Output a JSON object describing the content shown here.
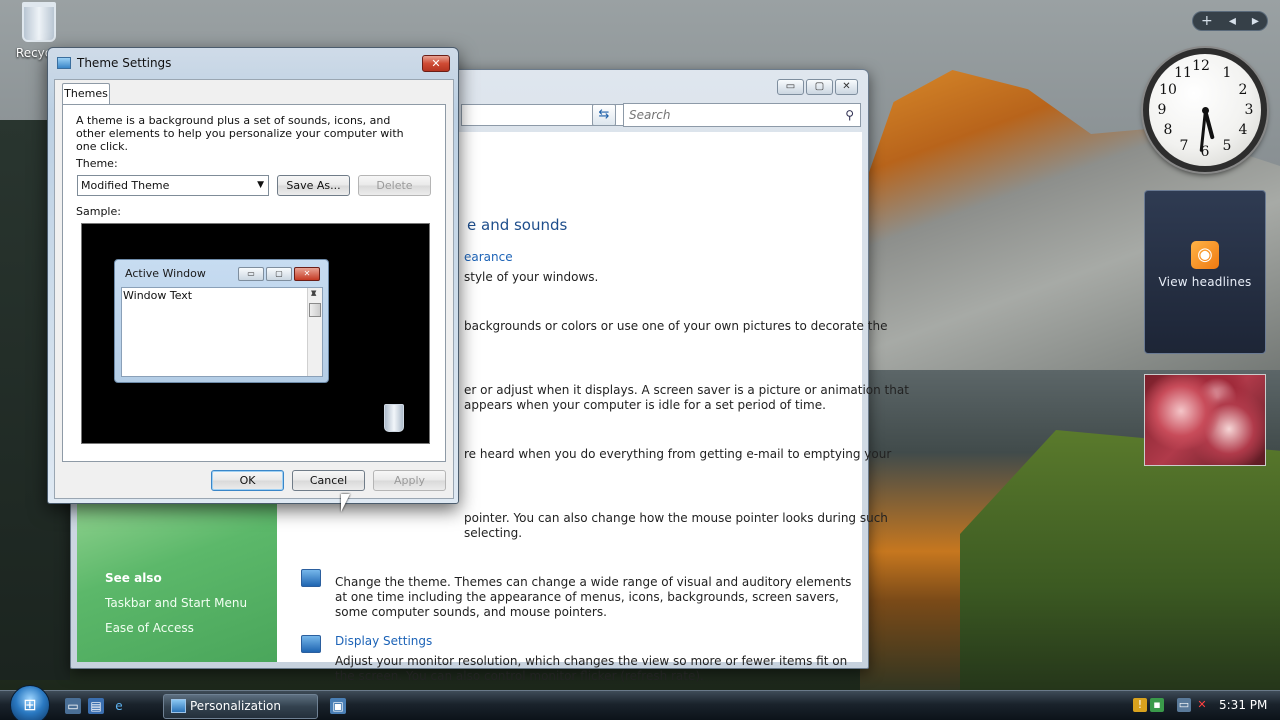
{
  "desktop": {
    "recycle_bin_label": "Recycle"
  },
  "gadgets": {
    "sidebar_controls": [
      "+",
      "◂",
      "▸"
    ],
    "clock_numbers": [
      "12",
      "1",
      "2",
      "3",
      "4",
      "5",
      "6",
      "7",
      "8",
      "9",
      "10",
      "11"
    ],
    "feed_label": "View headlines"
  },
  "control_panel": {
    "search_placeholder": "Search",
    "heading": "e and sounds",
    "snippets": [
      {
        "text": "earance",
        "type": "link"
      },
      {
        "text": "style of your windows.",
        "type": "text"
      },
      {
        "text": "backgrounds or colors or use one of your own pictures to decorate the",
        "type": "text"
      },
      {
        "text": "er or adjust when it displays. A screen saver is a picture or animation that",
        "type": "text"
      },
      {
        "text": "appears when your computer is idle for a set period of time.",
        "type": "text"
      },
      {
        "text": "re heard when you do everything from getting e-mail to emptying your",
        "type": "text"
      },
      {
        "text": "pointer. You can also change how the mouse pointer looks during such",
        "type": "text"
      },
      {
        "text": "selecting.",
        "type": "text"
      }
    ],
    "theme_item": {
      "description": "Change the theme. Themes can change a wide range of visual and auditory elements at one time including the appearance of menus, icons, backgrounds, screen savers, some computer sounds, and mouse pointers."
    },
    "display_item": {
      "title": "Display Settings",
      "description": "Adjust your monitor resolution, which changes the view so more or fewer items fit on the screen. You can also control monitor flicker (refresh rate)."
    },
    "see_also": {
      "title": "See also",
      "links": [
        "Taskbar and Start Menu",
        "Ease of Access"
      ]
    }
  },
  "dialog": {
    "title": "Theme Settings",
    "tab_label": "Themes",
    "intro": "A theme is a background plus a set of sounds, icons, and other elements to help you personalize your computer with one click.",
    "theme_label": "Theme:",
    "theme_value": "Modified Theme",
    "save_as_label": "Save As...",
    "delete_label": "Delete",
    "sample_label": "Sample:",
    "preview": {
      "window_title": "Active Window",
      "window_text": "Window Text"
    },
    "ok_label": "OK",
    "cancel_label": "Cancel",
    "apply_label": "Apply"
  },
  "taskbar": {
    "task_label": "Personalization",
    "time": "5:31 PM"
  },
  "colors": {
    "link": "#1c63b7",
    "heading": "#1e4e8c",
    "sidebar_green": "#5cb86a",
    "close_red": "#cf4b34"
  }
}
